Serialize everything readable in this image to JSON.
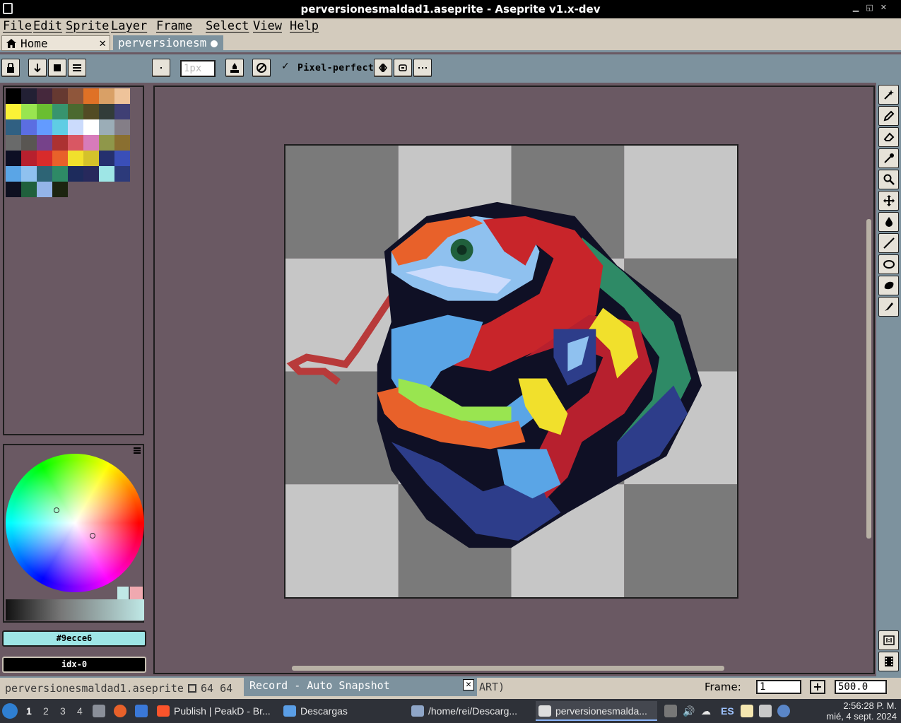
{
  "window": {
    "title": "perversionesmaldad1.aseprite - Aseprite v1.x-dev"
  },
  "menu": [
    "File",
    "Edit",
    "Sprite",
    "Layer",
    "Frame",
    "Select",
    "View",
    "Help"
  ],
  "tabs": {
    "home": "Home",
    "home_close": "✕",
    "doc": "perversionesm."
  },
  "toolbar": {
    "brush_size_placeholder": "1px",
    "pixel_perfect": "Pixel-perfect",
    "pixel_perfect_check": "✓"
  },
  "palette": {
    "colors": [
      "#000000",
      "#222034",
      "#45283c",
      "#663931",
      "#8f563b",
      "#df7126",
      "#d9a066",
      "#eec39a",
      "#fbf236",
      "#99e550",
      "#6abe30",
      "#37946e",
      "#4b692f",
      "#524b24",
      "#323c39",
      "#3f3f74",
      "#306082",
      "#5b6ee1",
      "#639bff",
      "#5fcde4",
      "#cbdbfc",
      "#ffffff",
      "#9badb7",
      "#847e87",
      "#696a6a",
      "#595652",
      "#76428a",
      "#ac3232",
      "#d95763",
      "#d77bba",
      "#8f974a",
      "#8a6f30",
      "#0d0f24",
      "#b7202e",
      "#d82b2b",
      "#e8612a",
      "#f1e02c",
      "#d4c22a",
      "#25306e",
      "#3a4fb8",
      "#5aa5e6",
      "#8fc1ef",
      "#2d6475",
      "#2e8a66",
      "#1d2b5c",
      "#27295c",
      "#9ee6e6",
      "#2c3a7a",
      "#0e1020",
      "#20603c",
      "#94b4e8",
      "#1c2410"
    ]
  },
  "colors": {
    "foreground": "#9ecce6",
    "foreground_fill": "#9ee6e6",
    "background": "idx-0"
  },
  "status": {
    "filename": "perversionesmaldad1.aseprite",
    "size": "64 64",
    "record": "Record - Auto Snapshot",
    "record_close": "✕",
    "tail": "ART)",
    "frame_label": "Frame:",
    "frame_value": "1",
    "plus": "+",
    "zoom": "500.0"
  },
  "taskbar": {
    "workspaces": [
      "1",
      "2",
      "3",
      "4"
    ],
    "tasks": [
      "Publish | PeakD - Br...",
      "Descargas",
      "/home/rei/Descarg...",
      "perversionesmalda..."
    ],
    "language": "ES",
    "time": "2:56:28 P. M.",
    "date": "mié, 4 sept. 2024"
  }
}
